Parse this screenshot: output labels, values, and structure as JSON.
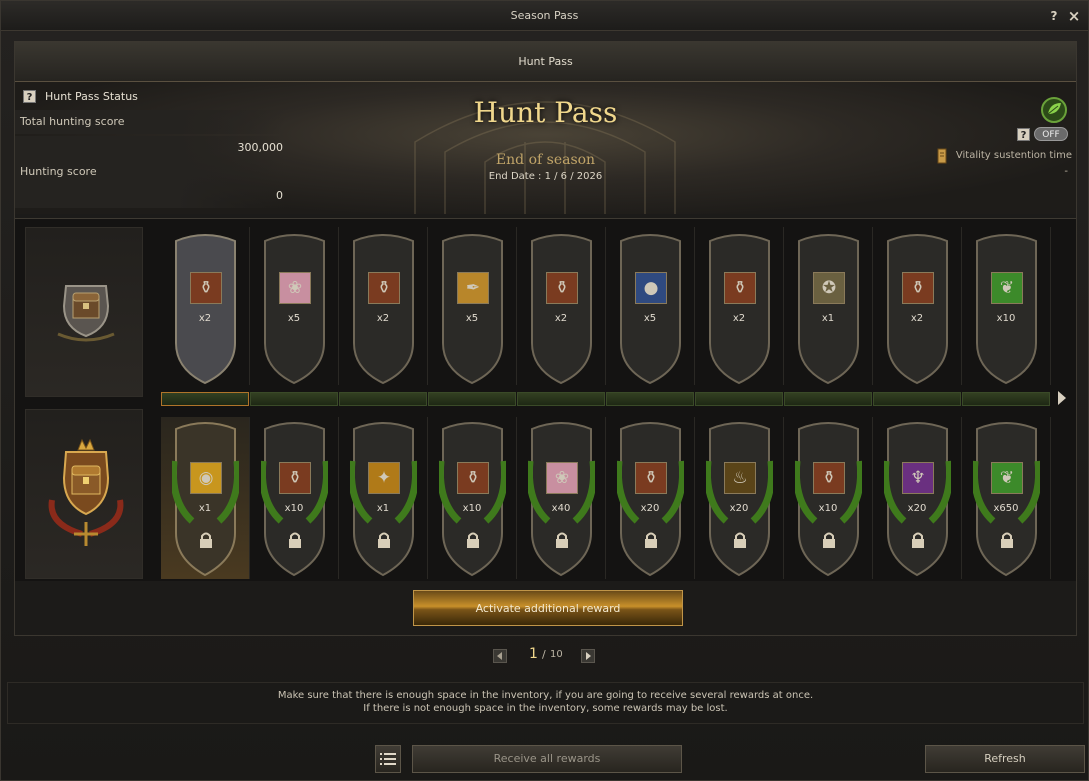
{
  "window": {
    "title": "Season Pass",
    "help_glyph": "?",
    "close_glyph": "×"
  },
  "tab": {
    "label": "Hunt Pass"
  },
  "status": {
    "header": "Hunt Pass Status",
    "total_label": "Total hunting score",
    "total_value": "300,000",
    "score_label": "Hunting score",
    "score_value": "0"
  },
  "banner": {
    "title": "Hunt Pass",
    "subtitle": "End of season",
    "end_date_label": "End Date :",
    "end_date_value": "1 / 6 / 2026"
  },
  "vitality": {
    "toggle": "OFF",
    "label": "Vitality sustention time",
    "value": "-"
  },
  "free_track": [
    {
      "icon": "potion-pouch-icon",
      "qty": "x2",
      "color": "#7a3b20"
    },
    {
      "icon": "rose-icon",
      "qty": "x5",
      "color": "#c88fa0"
    },
    {
      "icon": "potion-pouch-icon",
      "qty": "x2",
      "color": "#7a3b20"
    },
    {
      "icon": "golden-scroll-icon",
      "qty": "x5",
      "color": "#b8862a"
    },
    {
      "icon": "potion-pouch-icon",
      "qty": "x2",
      "color": "#7a3b20"
    },
    {
      "icon": "blue-orb-icon",
      "qty": "x5",
      "color": "#2f4a80"
    },
    {
      "icon": "potion-pouch-icon",
      "qty": "x2",
      "color": "#7a3b20"
    },
    {
      "icon": "compass-icon",
      "qty": "x1",
      "color": "#6a6040"
    },
    {
      "icon": "potion-pouch-icon",
      "qty": "x2",
      "color": "#7a3b20"
    },
    {
      "icon": "green-leaf-icon",
      "qty": "x10",
      "color": "#3c8a2a"
    }
  ],
  "premium_track": [
    {
      "icon": "gold-coin-icon",
      "qty": "x1",
      "color": "#c8961e"
    },
    {
      "icon": "potion-pouch-icon",
      "qty": "x10",
      "color": "#7a3b20"
    },
    {
      "icon": "golden-leaf-icon",
      "qty": "x1",
      "color": "#b07a18"
    },
    {
      "icon": "potion-pouch-icon",
      "qty": "x10",
      "color": "#7a3b20"
    },
    {
      "icon": "rose-icon",
      "qty": "x40",
      "color": "#c88fa0"
    },
    {
      "icon": "potion-pouch-icon",
      "qty": "x20",
      "color": "#7a3b20"
    },
    {
      "icon": "dark-elixir-icon",
      "qty": "x20",
      "color": "#5a4418"
    },
    {
      "icon": "potion-pouch-icon",
      "qty": "x10",
      "color": "#7a3b20"
    },
    {
      "icon": "purple-goblet-icon",
      "qty": "x20",
      "color": "#6a3080"
    },
    {
      "icon": "green-leaf-icon",
      "qty": "x650",
      "color": "#3c8a2a"
    }
  ],
  "progress": {
    "segments": 10,
    "filled": 0
  },
  "activate_button": "Activate additional reward",
  "pager": {
    "current": "1",
    "separator": "/",
    "total": "10"
  },
  "notice": {
    "line1": "Make sure that there is enough space in the inventory, if you are going to receive several rewards at once.",
    "line2": "If there is not enough space in the inventory, some rewards may be lost."
  },
  "buttons": {
    "receive_all": "Receive all rewards",
    "refresh": "Refresh"
  },
  "colors": {
    "accent_gold": "#f0d78c",
    "progress_green": "#334022",
    "wreath_green": "#3f7a1c"
  }
}
